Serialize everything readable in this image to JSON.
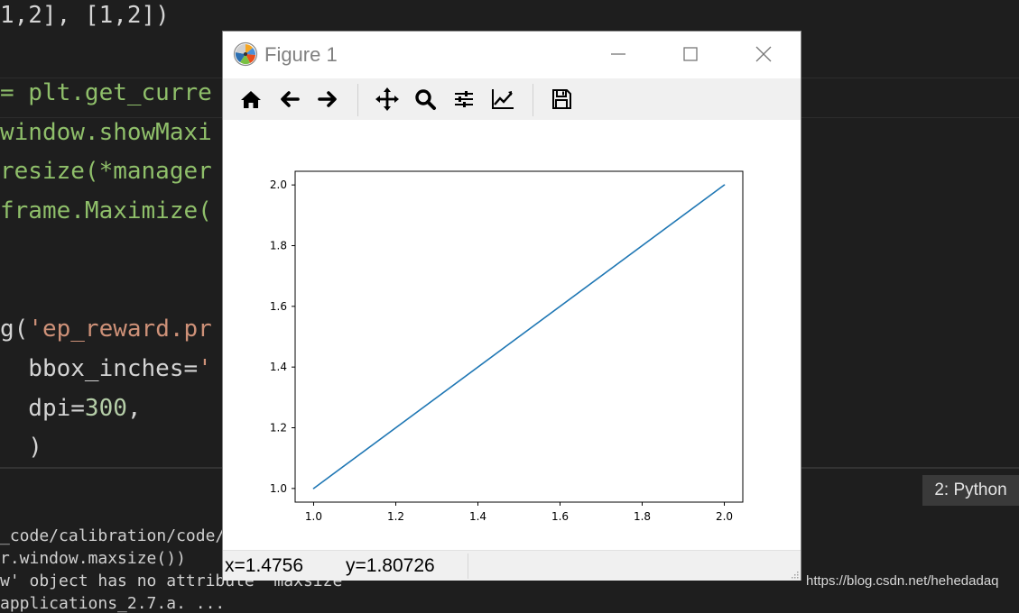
{
  "editor": {
    "lines": [
      {
        "segments": [
          {
            "t": "1,2], [1,2])",
            "c": "tok-op"
          }
        ]
      },
      {
        "segments": [
          {
            "t": "= plt.get_curre",
            "c": "tok-name"
          }
        ]
      },
      {
        "segments": [
          {
            "t": "window.showMaxi",
            "c": "tok-name"
          }
        ]
      },
      {
        "segments": [
          {
            "t": "resize(*manager",
            "c": "tok-name"
          }
        ]
      },
      {
        "segments": [
          {
            "t": "frame.Maximize(",
            "c": "tok-name"
          }
        ]
      },
      {
        "segments": [
          {
            "t": "g(",
            "c": "tok-op"
          },
          {
            "t": "'ep_reward.pr",
            "c": "tok-str"
          }
        ]
      },
      {
        "segments": [
          {
            "t": "  bbox_inches=",
            "c": "tok-op"
          },
          {
            "t": "'",
            "c": "tok-str"
          }
        ]
      },
      {
        "segments": [
          {
            "t": "  dpi=",
            "c": "tok-op"
          },
          {
            "t": "300",
            "c": "tok-num"
          },
          {
            "t": ",",
            "c": "tok-op"
          }
        ]
      },
      {
        "segments": [
          {
            "t": "  )",
            "c": "tok-op"
          }
        ]
      }
    ]
  },
  "terminal": {
    "lines": [
      "_code/calibration/code/",
      "r.window.maxsize())",
      "w' object has no attribute 'maxsize'",
      "applications_2.7.a. ..."
    ],
    "tab_label": "2: Python"
  },
  "watermark": "https://blog.csdn.net/hehedadaq",
  "figure": {
    "title": "Figure 1",
    "toolbar": [
      {
        "name": "home-icon",
        "title": "Home"
      },
      {
        "name": "back-arrow-icon",
        "title": "Back"
      },
      {
        "name": "forward-arrow-icon",
        "title": "Forward"
      },
      {
        "name": "pan-icon",
        "title": "Pan"
      },
      {
        "name": "zoom-icon",
        "title": "Zoom"
      },
      {
        "name": "configure-subplots-icon",
        "title": "Subplots"
      },
      {
        "name": "edit-axis-icon",
        "title": "Customize"
      },
      {
        "name": "save-icon",
        "title": "Save"
      }
    ],
    "status": {
      "x": "x=1.4756",
      "y": "y=1.80726"
    }
  },
  "chart_data": {
    "type": "line",
    "x": [
      1.0,
      2.0
    ],
    "series": [
      {
        "values": [
          1.0,
          2.0
        ],
        "color": "#1f77b4"
      }
    ],
    "xlim": [
      0.955,
      2.045
    ],
    "ylim": [
      0.955,
      2.045
    ],
    "xticks": [
      "1.0",
      "1.2",
      "1.4",
      "1.6",
      "1.8",
      "2.0"
    ],
    "yticks": [
      "1.0",
      "1.2",
      "1.4",
      "1.6",
      "1.8",
      "2.0"
    ],
    "grid": false,
    "title": "",
    "xlabel": "",
    "ylabel": ""
  }
}
